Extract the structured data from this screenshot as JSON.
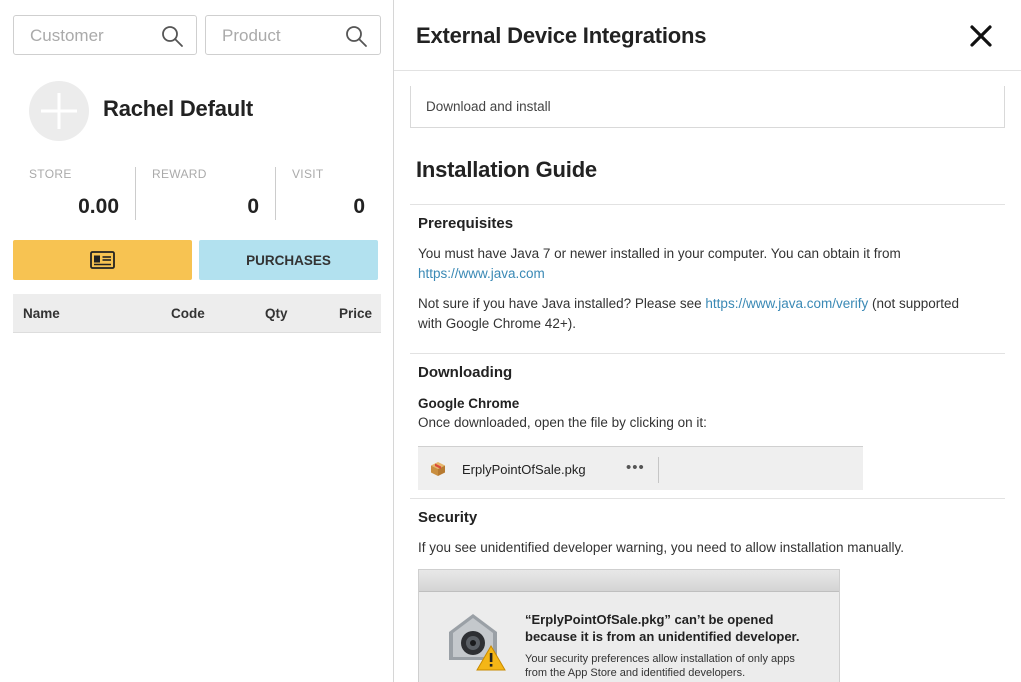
{
  "left": {
    "customer_search": {
      "placeholder": "Customer"
    },
    "product_search": {
      "placeholder": "Product"
    },
    "customer_name": "Rachel Default",
    "stats": [
      {
        "label": "STORE",
        "value": "0.00"
      },
      {
        "label": "REWARD",
        "value": "0"
      },
      {
        "label": "VISIT",
        "value": "0"
      }
    ],
    "buttons": {
      "card_icon": "id-card-icon",
      "purchases_label": "PURCHASES"
    },
    "table": {
      "columns": [
        "Name",
        "Code",
        "Qty",
        "Price"
      ]
    }
  },
  "modal": {
    "title": "External Device Integrations",
    "download_tab": "Download and install",
    "guide_title": "Installation Guide",
    "prerequisites": {
      "heading": "Prerequisites",
      "p1_text": "You must have Java 7 or newer installed in your computer. You can obtain it from",
      "p1_link": "https://www.java.com",
      "p2_before": "Not sure if you have Java installed? Please see ",
      "p2_link": "https://www.java.com/verify",
      "p2_after": " (not supported with Google Chrome 42+)."
    },
    "downloading": {
      "heading": "Downloading",
      "subheading": "Google Chrome",
      "text": "Once downloaded, open the file by clicking on it:",
      "file_name": "ErplyPointOfSale.pkg",
      "more": "•••"
    },
    "security": {
      "heading": "Security",
      "text": "If you see unidentified developer warning, you need to allow installation manually.",
      "dialog_title": "“ErplyPointOfSale.pkg” can’t be opened because it is from an unidentified developer.",
      "dialog_text": "Your security preferences allow installation of only apps from the App Store and identified developers."
    }
  },
  "colors": {
    "accent_yellow": "#f7c352",
    "accent_blue": "#b2e1ef",
    "link": "#3a89b5"
  }
}
